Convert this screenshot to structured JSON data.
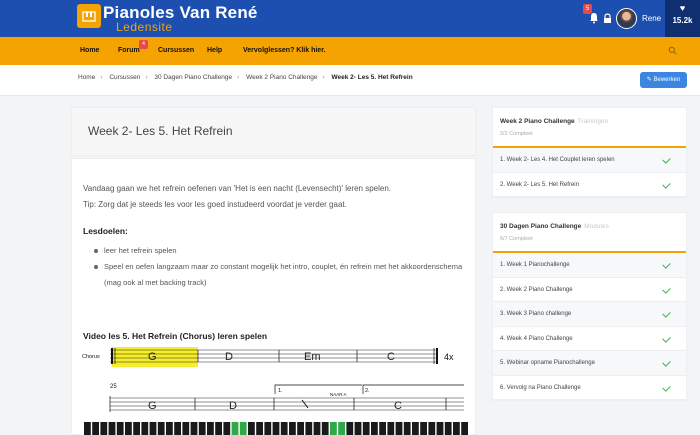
{
  "header": {
    "brand_title": "Pianoles Van René",
    "brand_subtitle": "Ledensite",
    "notification_count": "5",
    "user_name": "Rene",
    "points": "15.2k"
  },
  "nav": {
    "items": [
      "Home",
      "Forum",
      "Cursussen",
      "Help",
      "Vervolglessen? Klik hier."
    ],
    "forum_badge": "4"
  },
  "breadcrumb": {
    "items": [
      "Home",
      "Cursussen",
      "30 Dagen Piano Challenge",
      "Week 2 Piano Challenge",
      "Week 2- Les 5. Het Refrein"
    ],
    "edit_label": "Bewerken"
  },
  "lesson": {
    "title": "Week 2- Les 5. Het Refrein",
    "intro_line1": "Vandaag gaan we het refrein oefenen van 'Het is een nacht (Levensecht)' leren spelen.",
    "intro_line2": "Tip: Zorg dat je steeds les voor les goed instudeerd voordat je verder gaat.",
    "goals_heading": "Lesdoelen:",
    "goals": [
      "leer het refrein spelen",
      "Speel en oefen langzaam maar zo constant mogelijk het intro, couplet, én refrein met het akkoordenschema (mag ook al met backing track)"
    ],
    "video_heading": "Video les 5. Het Refrein (Chorus) leren spelen",
    "sheet": {
      "section_label": "Chorus",
      "chords_row1": [
        "G",
        "D",
        "Em",
        "C"
      ],
      "repeat": "4x",
      "bar_number": "25",
      "chords_row2": [
        "G",
        "D",
        "C"
      ],
      "volta1": "1.",
      "volta2": "2.",
      "naar_a": "NAAR A"
    }
  },
  "sidebar": {
    "week": {
      "title": "Week 2 Piano Challenge",
      "type": "Trainingen",
      "progress": "2/2 Compleet",
      "items": [
        "1. Week 2- Les 4. Het Couplet leren spelen",
        "2. Week 2- Les 5. Het Refrein"
      ]
    },
    "challenge": {
      "title": "30 Dagen Piano Challenge",
      "type": "Modules",
      "progress": "6/7 Compleet",
      "items": [
        "1. Week 1 Pianochallenge",
        "2. Week 2 Piano Challenge",
        "3. Week 3 Piano challenge",
        "4. Week 4 Piano Challenge",
        "5. Webinar opname Pianochallenge",
        "6. Vervolg na Piano Challenge"
      ]
    }
  },
  "colors": {
    "header_blue": "#1d4fb1",
    "accent_orange": "#f5a300",
    "check_green": "#3bb44a",
    "button_blue": "#3a86e0"
  }
}
